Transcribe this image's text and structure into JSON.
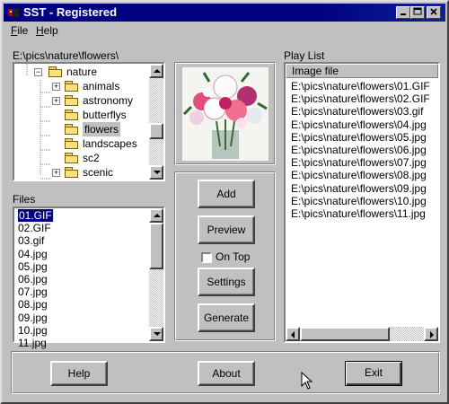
{
  "window": {
    "title": "SST - Registered"
  },
  "menu": [
    {
      "label": "File",
      "accel": "F",
      "rest": "ile"
    },
    {
      "label": "Help",
      "accel": "H",
      "rest": "elp"
    }
  ],
  "folder_tree": {
    "path_label": "E:\\pics\\nature\\flowers\\",
    "items": [
      {
        "label": "nature",
        "expander": "−"
      },
      {
        "label": "animals",
        "expander": "+"
      },
      {
        "label": "astronomy",
        "expander": "+"
      },
      {
        "label": "butterflys",
        "expander": ""
      },
      {
        "label": "flowers",
        "expander": ""
      },
      {
        "label": "landscapes",
        "expander": ""
      },
      {
        "label": "sc2",
        "expander": ""
      },
      {
        "label": "scenic",
        "expander": "+"
      }
    ],
    "selected": "flowers"
  },
  "files": {
    "label": "Files",
    "items": [
      "01.GIF",
      "02.GIF",
      "03.gif",
      "04.jpg",
      "05.jpg",
      "06.jpg",
      "07.jpg",
      "08.jpg",
      "09.jpg",
      "10.jpg",
      "11.jpg"
    ],
    "selected": "01.GIF"
  },
  "controls": {
    "add": "Add",
    "preview": "Preview",
    "on_top": "On Top",
    "on_top_checked": false,
    "settings": "Settings",
    "generate": "Generate"
  },
  "playlist": {
    "label": "Play List",
    "column": "Image file",
    "items": [
      "E:\\pics\\nature\\flowers\\01.GIF",
      "E:\\pics\\nature\\flowers\\02.GIF",
      "E:\\pics\\nature\\flowers\\03.gif",
      "E:\\pics\\nature\\flowers\\04.jpg",
      "E:\\pics\\nature\\flowers\\05.jpg",
      "E:\\pics\\nature\\flowers\\06.jpg",
      "E:\\pics\\nature\\flowers\\07.jpg",
      "E:\\pics\\nature\\flowers\\08.jpg",
      "E:\\pics\\nature\\flowers\\09.jpg",
      "E:\\pics\\nature\\flowers\\10.jpg",
      "E:\\pics\\nature\\flowers\\11.jpg"
    ]
  },
  "footer": {
    "help": "Help",
    "about": "About",
    "exit": "Exit"
  },
  "colors": {
    "title_bar": "#000080",
    "face": "#c0c0c0",
    "selection": "#000080"
  }
}
